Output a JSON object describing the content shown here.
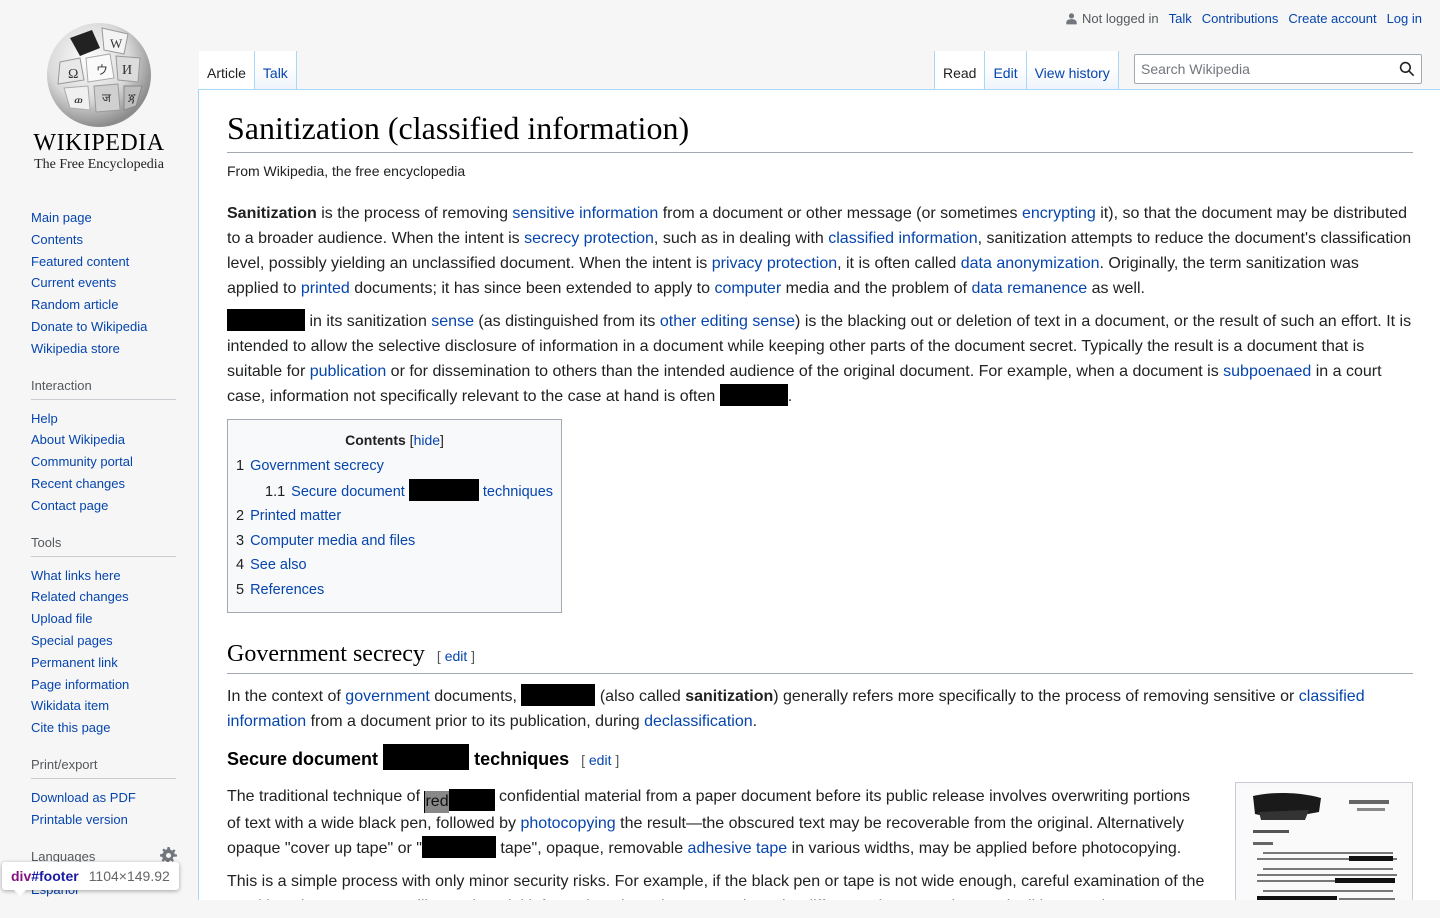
{
  "logo": {
    "wordmark": "WIKIPEDIA",
    "tagline": "The Free Encyclopedia"
  },
  "personal": {
    "not_logged_in": "Not logged in",
    "talk": "Talk",
    "contributions": "Contributions",
    "create_account": "Create account",
    "log_in": "Log in"
  },
  "tabs": {
    "article": "Article",
    "talk": "Talk",
    "read": "Read",
    "edit": "Edit",
    "view_history": "View history"
  },
  "search": {
    "placeholder": "Search Wikipedia"
  },
  "sidebar": {
    "navigation": [
      "Main page",
      "Contents",
      "Featured content",
      "Current events",
      "Random article",
      "Donate to Wikipedia",
      "Wikipedia store"
    ],
    "interaction_heading": "Interaction",
    "interaction": [
      "Help",
      "About Wikipedia",
      "Community portal",
      "Recent changes",
      "Contact page"
    ],
    "tools_heading": "Tools",
    "tools": [
      "What links here",
      "Related changes",
      "Upload file",
      "Special pages",
      "Permanent link",
      "Page information",
      "Wikidata item",
      "Cite this page"
    ],
    "print_heading": "Print/export",
    "print": [
      "Download as PDF",
      "Printable version"
    ],
    "languages_heading": "Languages",
    "languages": [
      "Español"
    ]
  },
  "article": {
    "title": "Sanitization (classified information)",
    "sitesub": "From Wikipedia, the free encyclopedia",
    "p1": {
      "bold": "Sanitization",
      "t1": " is the process of removing ",
      "l1": "sensitive information",
      "t2": " from a document or other message (or sometimes ",
      "l2": "encrypting",
      "t3": " it), so that the document may be distributed to a broader audience. When the intent is ",
      "l3": "secrecy protection",
      "t4": ", such as in dealing with ",
      "l4": "classified information",
      "t5": ", sanitization attempts to reduce the document's classification level, possibly yielding an unclassified document. When the intent is ",
      "l5": "privacy protection",
      "t6": ", it is often called ",
      "l6": "data anonymization",
      "t7": ". Originally, the term sanitization was applied to ",
      "l7": "printed",
      "t8": " documents; it has since been extended to apply to ",
      "l8": "computer",
      "t9": " media and the problem of ",
      "l9": "data remanence",
      "t10": " as well."
    },
    "p2": {
      "t1": " in its sanitization ",
      "l1": "sense",
      "t2": " (as distinguished from its ",
      "l2": "other editing sense",
      "t3": ") is the blacking out or deletion of text in a document, or the result of such an effort. It is intended to allow the selective disclosure of information in a document while keeping other parts of the document secret. Typically the result is a document that is suitable for ",
      "l3": "publication",
      "t4": " or for dissemination to others than the intended audience of the original document. For example, when a document is ",
      "l4": "subpoenaed",
      "t5": " in a court case, information not specifically relevant to the case at hand is often ",
      "t6": "."
    },
    "toc": {
      "title": "Contents",
      "hide": "hide",
      "items": [
        {
          "num": "1",
          "pre": "Government secrecy"
        },
        {
          "num": "1.1",
          "pre": "Secure document",
          "post": "techniques"
        },
        {
          "num": "2",
          "pre": "Printed matter"
        },
        {
          "num": "3",
          "pre": "Computer media and files"
        },
        {
          "num": "4",
          "pre": "See also"
        },
        {
          "num": "5",
          "pre": "References"
        }
      ]
    },
    "h2_gov": "Government secrecy",
    "edit": "edit",
    "p3": {
      "t1": "In the context of ",
      "l1": "government",
      "t2": " documents, ",
      "t3": " (also called ",
      "b1": "sanitization",
      "t4": ") generally refers more specifically to the process of removing sensitive or ",
      "l2": "classified information",
      "t5": " from a document prior to its publication, during ",
      "l3": "declassification",
      "t6": "."
    },
    "h3_secure_pre": "Secure document",
    "h3_secure_post": "techniques",
    "p4": {
      "t1": "The traditional technique of ",
      "partial": "red",
      "t2": " confidential material from a paper document before its public release involves overwriting portions of text with a wide black pen, followed by ",
      "l1": "photocopying",
      "t3": " the result—the obscured text may be recoverable from the original. Alternatively opaque \"cover up tape\" or \"",
      "t4": " tape\", opaque, removable ",
      "l2": "adhesive tape",
      "t5": " in various widths, may be applied before photocopying."
    },
    "p5": "This is a simple process with only minor security risks. For example, if the black pen or tape is not wide enough, careful examination of the resulting photocopy may still reveal partial information about the text, such as the difference between short and tall letters. The exact length"
  },
  "tooltip": {
    "tag": "div",
    "id": "#footer",
    "dims": "1104×149.92"
  }
}
